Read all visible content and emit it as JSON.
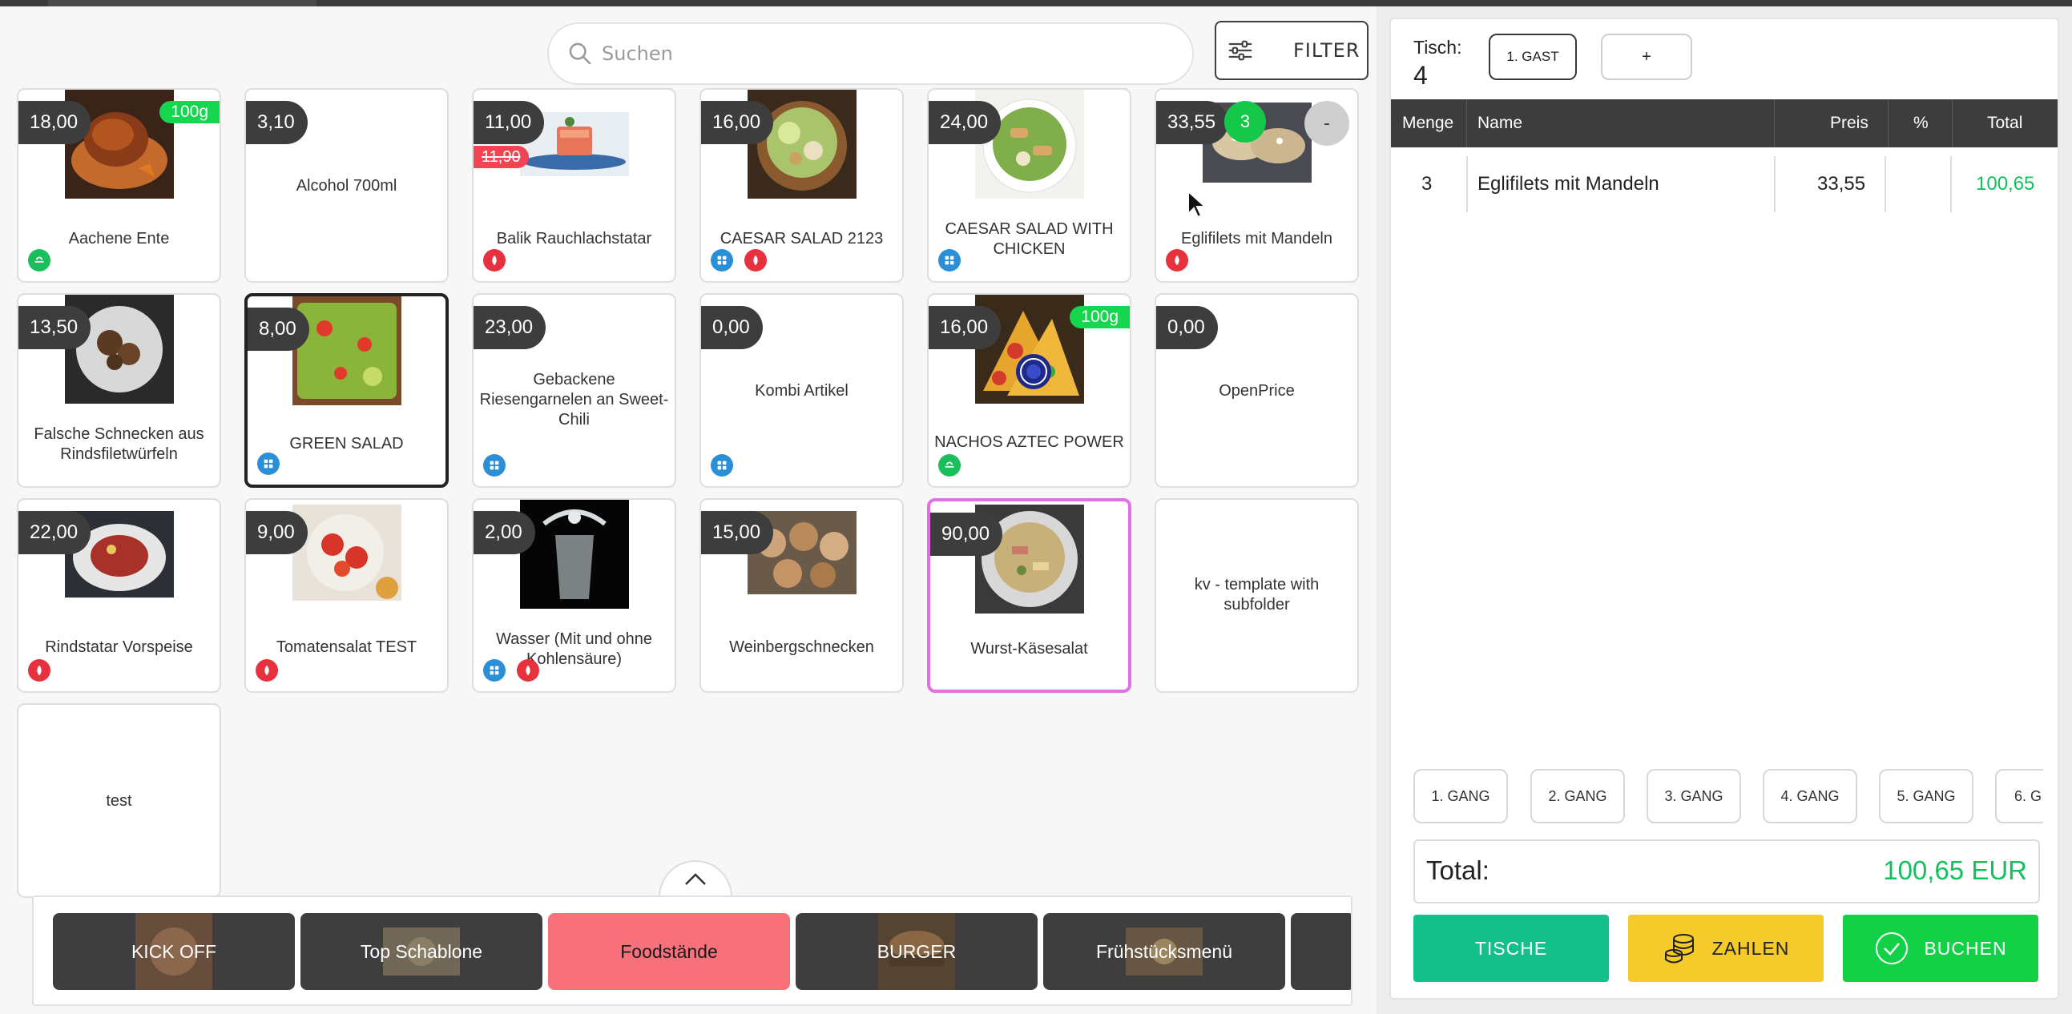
{
  "search": {
    "placeholder": "Suchen"
  },
  "filter": {
    "label": "FILTER"
  },
  "products": [
    {
      "name": "Aachene Ente",
      "price": "18,00",
      "weight": "100g",
      "tags": [
        "green"
      ]
    },
    {
      "name": "Alcohol 700ml",
      "price": "3,10",
      "tags": []
    },
    {
      "name": "Balik Rauchlachstatar",
      "price": "11,00",
      "old_price": "11,90",
      "tags": [
        "red"
      ]
    },
    {
      "name": "CAESAR SALAD 2123",
      "price": "16,00",
      "tags": [
        "blue",
        "red"
      ]
    },
    {
      "name": "CAESAR SALAD WITH CHICKEN",
      "price": "24,00",
      "tags": [
        "blue"
      ]
    },
    {
      "name": "Eglifilets mit Mandeln",
      "price": "33,55",
      "qty": "3",
      "minus": "-",
      "tags": [
        "red"
      ]
    },
    {
      "name": "Falsche Schnecken aus Rindsfiletwürfeln",
      "price": "13,50",
      "tags": []
    },
    {
      "name": "GREEN SALAD",
      "price": "8,00",
      "tags": [
        "blue"
      ]
    },
    {
      "name": "Gebackene Riesengarnelen an Sweet-Chili",
      "price": "23,00",
      "tags": [
        "blue"
      ]
    },
    {
      "name": "Kombi Artikel",
      "price": "0,00",
      "tags": [
        "blue"
      ]
    },
    {
      "name": "NACHOS AZTEC POWER",
      "price": "16,00",
      "weight": "100g",
      "tags": [
        "green"
      ]
    },
    {
      "name": "OpenPrice",
      "price": "0,00",
      "tags": []
    },
    {
      "name": "Rindstatar Vorspeise",
      "price": "22,00",
      "tags": [
        "red"
      ]
    },
    {
      "name": "Tomatensalat TEST",
      "price": "9,00",
      "tags": [
        "red"
      ]
    },
    {
      "name": "Wasser (Mit und ohne Kohlensäure)",
      "price": "2,00",
      "tags": [
        "blue",
        "red"
      ]
    },
    {
      "name": "Weinbergschnecken",
      "price": "15,00",
      "tags": []
    },
    {
      "name": "Wurst-Käsesalat",
      "price": "90,00",
      "tags": []
    },
    {
      "name": "kv - template with subfolder",
      "tags": []
    },
    {
      "name": "test",
      "tags": []
    }
  ],
  "categories": [
    {
      "label": "KICK OFF"
    },
    {
      "label": "Top Schablone"
    },
    {
      "label": "Foodstände",
      "active": true
    },
    {
      "label": "BURGER"
    },
    {
      "label": "Frühstücksmenü"
    }
  ],
  "order": {
    "tisch_label": "Tisch:",
    "tisch_number": "4",
    "guest_label": "1. GAST",
    "add_label": "+",
    "columns": {
      "menge": "Menge",
      "name": "Name",
      "preis": "Preis",
      "rabatt": "%",
      "total": "Total"
    },
    "items": [
      {
        "menge": "3",
        "name": "Eglifilets mit Mandeln",
        "preis": "33,55",
        "rabatt": "",
        "total": "100,65"
      }
    ],
    "gang_buttons": [
      "1. GANG",
      "2. GANG",
      "3. GANG",
      "4. GANG",
      "5. GANG",
      "6. G"
    ],
    "total_label": "Total:",
    "total_value": "100,65 EUR",
    "actions": {
      "tische": "TISCHE",
      "zahlen": "ZAHLEN",
      "buchen": "BUCHEN"
    }
  },
  "colors": {
    "accent_green": "#13d147",
    "accent_teal": "#14c08a",
    "accent_yellow": "#f5ca2b",
    "active_category": "#f7707a",
    "price_badge": "#3d3d3d",
    "selected_pink": "#e26fe6"
  }
}
